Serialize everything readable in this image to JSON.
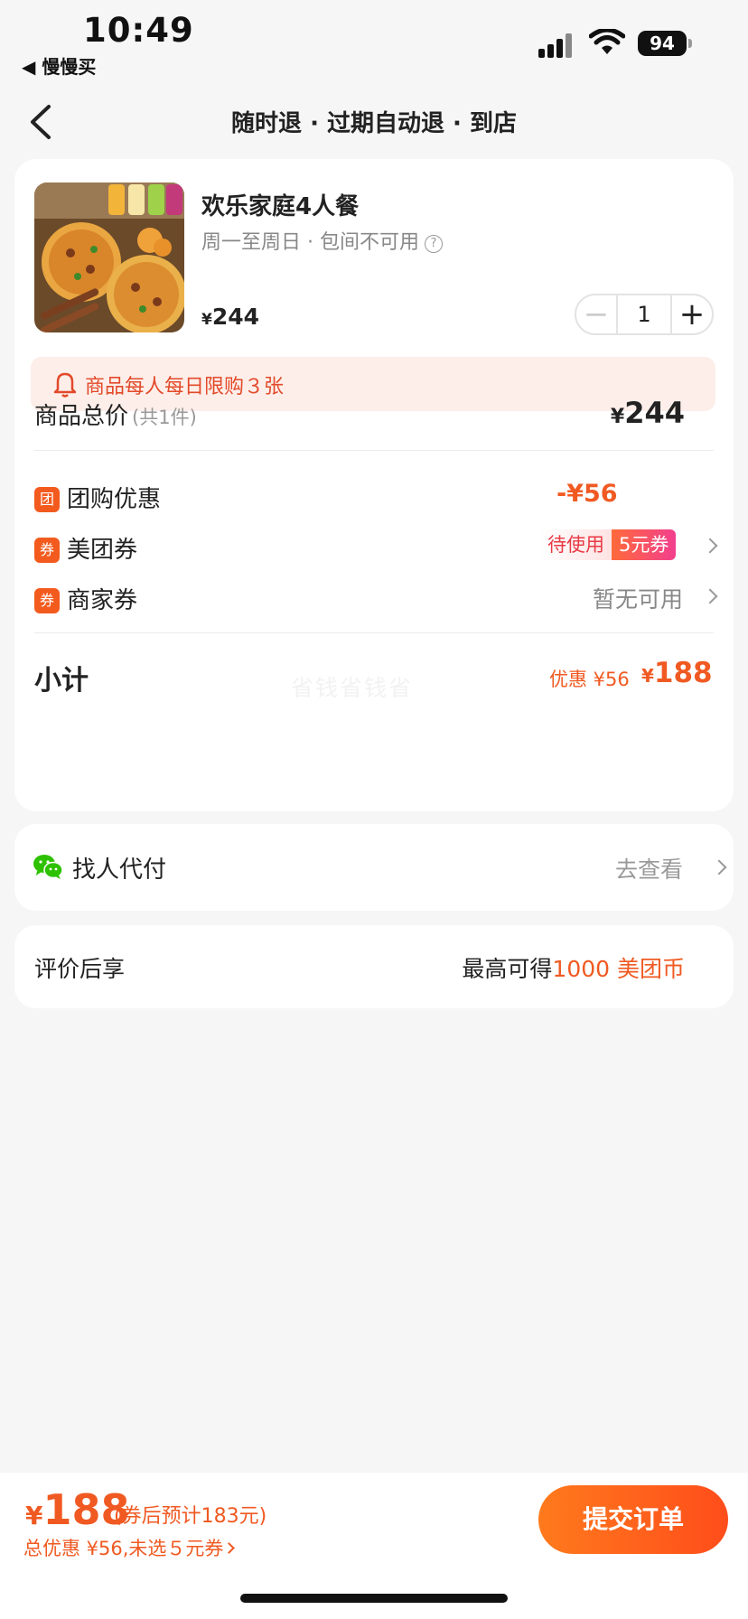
{
  "status_bar": {
    "time": "10:49",
    "back_app": "◀ 慢慢买",
    "battery": "94"
  },
  "nav": {
    "title": "随时退 · 过期自动退 · 到店"
  },
  "product": {
    "name": "欢乐家庭4人餐",
    "subtitle": "周一至周日 · 包间不可用",
    "price_symbol": "¥",
    "price": "244",
    "quantity": "1"
  },
  "limit_notice": "商品每人每日限购３张",
  "total": {
    "label": "商品总价",
    "count": "(共1件)",
    "symbol": "¥",
    "value": "244"
  },
  "discounts": {
    "group_badge": "团",
    "group_label": "团购优惠",
    "group_value": "-¥56",
    "meituan_badge": "券",
    "meituan_label": "美团券",
    "meituan_status": "待使用",
    "meituan_amount": "5元券",
    "merchant_badge": "券",
    "merchant_label": "商家券",
    "merchant_value": "暂无可用"
  },
  "subtotal": {
    "label": "小计",
    "discount": "优惠 ¥56",
    "symbol": "¥",
    "value": "188",
    "watermark": "省钱省钱省"
  },
  "pay_for_me": {
    "label": "找人代付",
    "action": "去查看"
  },
  "review": {
    "label": "评价后享",
    "prefix": "最高可得",
    "highlight": "1000 美团币"
  },
  "bottom": {
    "symbol": "¥",
    "price": "188",
    "after_coupon": "(券后预计183元)",
    "total_discount": "总优惠 ¥56,未选５元券",
    "submit": "提交订单"
  },
  "colors": {
    "accent": "#f05a22",
    "notice_bg": "#fdeee9",
    "submit_from": "#ff7a1c",
    "submit_to": "#ff4d1b"
  }
}
